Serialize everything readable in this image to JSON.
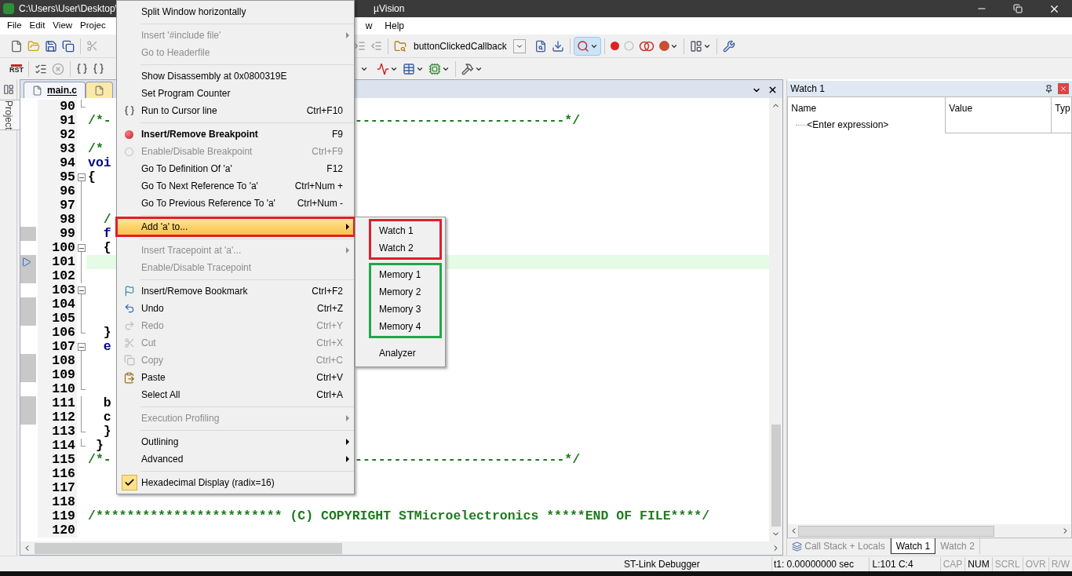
{
  "window": {
    "title_left": "C:\\Users\\User\\Desktop\\",
    "title_right": "µVision"
  },
  "menubar": {
    "items_left": [
      "File",
      "Edit",
      "View",
      "Projec"
    ],
    "items_right": [
      "w",
      "Help"
    ]
  },
  "toolbar": {
    "function_combo": "buttonClickedCallback",
    "reset_label": "RST"
  },
  "sidebar": {
    "tab": "Project"
  },
  "editor": {
    "tabs": [
      {
        "label": "main.c",
        "selected": true
      },
      {
        "selected": false
      }
    ],
    "lines": [
      {
        "number": "90",
        "fold_end": true
      },
      {
        "number": "91",
        "left": "/*-",
        "right": "---------------------------*/",
        "kind": "comment"
      },
      {
        "number": "92"
      },
      {
        "number": "93",
        "left": "/* ",
        "kind": "comment"
      },
      {
        "number": "94",
        "left": "voi",
        "kind": "keyword"
      },
      {
        "number": "95",
        "left": "{",
        "fold_start": true,
        "kind": "plain"
      },
      {
        "number": "96",
        "in_fold": true
      },
      {
        "number": "97",
        "in_fold": true
      },
      {
        "number": "98",
        "left": "  /",
        "in_fold": true,
        "kind": "comment"
      },
      {
        "number": "99",
        "left": "  f",
        "in_fold": true,
        "kind": "keyword",
        "covered": true
      },
      {
        "number": "100",
        "left": "  {",
        "fold_start": true,
        "kind": "plain"
      },
      {
        "number": "101",
        "in_fold": true,
        "covered": true,
        "current": true
      },
      {
        "number": "102",
        "in_fold": true,
        "covered": true
      },
      {
        "number": "103",
        "fold_start": true
      },
      {
        "number": "104",
        "in_fold": true,
        "covered": true
      },
      {
        "number": "105",
        "in_fold": true,
        "covered": true
      },
      {
        "number": "106",
        "left": "  }",
        "fold_end": true,
        "kind": "plain"
      },
      {
        "number": "107",
        "left": "  e",
        "fold_start": true,
        "kind": "keyword"
      },
      {
        "number": "108",
        "in_fold": true,
        "covered": true
      },
      {
        "number": "109",
        "in_fold": true,
        "covered": true
      },
      {
        "number": "110",
        "fold_end": true
      },
      {
        "number": "111",
        "left": "  b",
        "in_fold": true,
        "kind": "plain",
        "covered": true
      },
      {
        "number": "112",
        "left": "  c",
        "in_fold": true,
        "kind": "plain",
        "covered": true
      },
      {
        "number": "113",
        "left": "  }",
        "fold_end": true,
        "kind": "plain"
      },
      {
        "number": "114",
        "left": " }",
        "fold_end": true,
        "kind": "plain"
      },
      {
        "number": "115",
        "left": "/*-",
        "right": "---------------------------*/",
        "kind": "comment"
      },
      {
        "number": "116"
      },
      {
        "number": "117"
      },
      {
        "number": "118"
      },
      {
        "number": "119",
        "left": "/************************ (C) COPYRIGHT STMicroelectronics *****END OF FILE****/",
        "kind": "comment"
      },
      {
        "number": "120"
      }
    ]
  },
  "context_menu": {
    "items": [
      {
        "kind": "item",
        "label": "Split Window horizontally",
        "disabled": false,
        "selected": false
      },
      {
        "kind": "separator"
      },
      {
        "kind": "item",
        "label": "Insert '#include file'",
        "disabled": true,
        "submenu": true,
        "selected": false
      },
      {
        "kind": "item",
        "label": "Go to Headerfile",
        "disabled": true,
        "selected": false
      },
      {
        "kind": "separator"
      },
      {
        "kind": "item",
        "label": "Show Disassembly at 0x0800319E",
        "disabled": false,
        "selected": false
      },
      {
        "kind": "item",
        "label": "Set Program Counter",
        "disabled": false,
        "selected": false
      },
      {
        "kind": "run",
        "label": "Run to Cursor line",
        "shortcut": "Ctrl+F10",
        "disabled": false,
        "selected": false
      },
      {
        "kind": "separator"
      },
      {
        "kind": "breakpoint",
        "label": "Insert/Remove Breakpoint",
        "shortcut": "F9",
        "bold": true,
        "disabled": false,
        "selected": false
      },
      {
        "kind": "circle",
        "label": "Enable/Disable Breakpoint",
        "shortcut": "Ctrl+F9",
        "disabled": true,
        "selected": false
      },
      {
        "kind": "item",
        "label": "Go To Definition Of 'a'",
        "shortcut": "F12",
        "disabled": false,
        "selected": false
      },
      {
        "kind": "item",
        "label": "Go To Next Reference To 'a'",
        "shortcut": "Ctrl+Num +",
        "disabled": false,
        "selected": false
      },
      {
        "kind": "item",
        "label": "Go To Previous Reference To 'a'",
        "shortcut": "Ctrl+Num -",
        "disabled": false,
        "selected": false
      },
      {
        "kind": "separator"
      },
      {
        "kind": "item",
        "label": "Add 'a' to...",
        "submenu": true,
        "disabled": false,
        "selected": true,
        "annotated": true
      },
      {
        "kind": "separator"
      },
      {
        "kind": "item",
        "label": "Insert Tracepoint at 'a'...",
        "submenu": true,
        "disabled": true,
        "selected": false
      },
      {
        "kind": "item",
        "label": "Enable/Disable Tracepoint",
        "disabled": true,
        "selected": false
      },
      {
        "kind": "separator"
      },
      {
        "kind": "bookmark",
        "label": "Insert/Remove Bookmark",
        "shortcut": "Ctrl+F2",
        "disabled": false,
        "selected": false
      },
      {
        "kind": "undo",
        "label": "Undo",
        "shortcut": "Ctrl+Z",
        "disabled": false,
        "selected": false
      },
      {
        "kind": "redo",
        "label": "Redo",
        "shortcut": "Ctrl+Y",
        "disabled": true,
        "selected": false
      },
      {
        "kind": "cut",
        "label": "Cut",
        "shortcut": "Ctrl+X",
        "disabled": true,
        "selected": false
      },
      {
        "kind": "copy",
        "label": "Copy",
        "shortcut": "Ctrl+C",
        "disabled": true,
        "selected": false
      },
      {
        "kind": "paste",
        "label": "Paste",
        "shortcut": "Ctrl+V",
        "disabled": false,
        "selected": false
      },
      {
        "kind": "item",
        "label": "Select All",
        "shortcut": "Ctrl+A",
        "disabled": false,
        "selected": false
      },
      {
        "kind": "separator"
      },
      {
        "kind": "item",
        "label": "Execution Profiling",
        "submenu": true,
        "disabled": true,
        "selected": false
      },
      {
        "kind": "separator"
      },
      {
        "kind": "item",
        "label": "Outlining",
        "submenu": true,
        "disabled": false,
        "selected": false
      },
      {
        "kind": "item",
        "label": "Advanced",
        "submenu": true,
        "disabled": false,
        "selected": false
      },
      {
        "kind": "separator"
      },
      {
        "kind": "item",
        "label": "Hexadecimal Display (radix=16)",
        "checked": true,
        "disabled": false,
        "selected": false
      }
    ]
  },
  "submenu": {
    "groups": [
      {
        "color": "#e01e2b",
        "items": [
          "Watch 1",
          "Watch 2"
        ]
      },
      {
        "color": "#1fa84a",
        "items": [
          "Memory 1",
          "Memory 2",
          "Memory 3",
          "Memory 4"
        ]
      },
      {
        "items": [
          "Analyzer"
        ]
      }
    ]
  },
  "watch_panel": {
    "title": "Watch 1",
    "columns": [
      "Name",
      "Value",
      "Typ"
    ],
    "rows": [
      {
        "name": "<Enter expression>"
      }
    ],
    "tabs": [
      {
        "label": "Call Stack + Locals",
        "selected": false
      },
      {
        "label": "Watch 1",
        "selected": true
      },
      {
        "label": "Watch 2",
        "selected": false
      }
    ]
  },
  "status_bar": {
    "debugger": "ST-Link Debugger",
    "time": "t1: 0.00000000 sec",
    "position": "L:101 C:4",
    "indicators": [
      {
        "label": "CAP",
        "on": false
      },
      {
        "label": "NUM",
        "on": true
      },
      {
        "label": "SCRL",
        "on": false
      },
      {
        "label": "OVR",
        "on": false
      },
      {
        "label": "R/W",
        "on": false
      }
    ]
  }
}
